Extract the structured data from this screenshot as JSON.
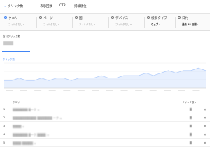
{
  "metrics": [
    {
      "label": "クリック数",
      "checked": true
    },
    {
      "label": "表示回数",
      "checked": false
    },
    {
      "label": "CTR",
      "checked": false
    },
    {
      "label": "掲載順位",
      "checked": false
    }
  ],
  "filters": [
    {
      "label": "クエリ",
      "sub": "フィルタなし",
      "selected": true
    },
    {
      "label": "ページ",
      "sub": "フィルタなし",
      "selected": false
    },
    {
      "label": "国",
      "sub": "フィルタなし",
      "selected": false
    },
    {
      "label": "デバイス",
      "sub": "フィルタなし",
      "selected": false
    },
    {
      "label": "検索タイプ",
      "sub": "ウェブ",
      "selected": false
    },
    {
      "label": "日付",
      "sub": "過去 28 日間",
      "selected": false
    }
  ],
  "kpi": {
    "label": "合計クリック数"
  },
  "chart": {
    "title": "クリック数"
  },
  "chart_data": {
    "type": "area",
    "series": [
      {
        "values": [
          3,
          3,
          4,
          3,
          3,
          4,
          3,
          4,
          4,
          3,
          4,
          4,
          4,
          5,
          4,
          4,
          5,
          5,
          5,
          6,
          5,
          6,
          7,
          6,
          7,
          7,
          8,
          7
        ]
      }
    ],
    "color": "#4285f4"
  },
  "table": {
    "col_query": "クエリ",
    "col_clicks": "クリック数 ▾",
    "rows": [
      {
        "num": "1",
        "query": "▒▒▒▒▒▒▒ ▒ーク"
      },
      {
        "num": "2",
        "query": "▒▒▒▒▒▒▒▒▒▒▒ ▒▒▒▒▒▒▒ ーク"
      },
      {
        "num": "3",
        "query": "▒▒▒▒"
      },
      {
        "num": "4",
        "query": "▒▒▒▒▒▒▒ ▒ーク ▒▒▒▒"
      },
      {
        "num": "5",
        "query": "▒▒▒▒ ▒▒▒▒▒"
      }
    ]
  }
}
